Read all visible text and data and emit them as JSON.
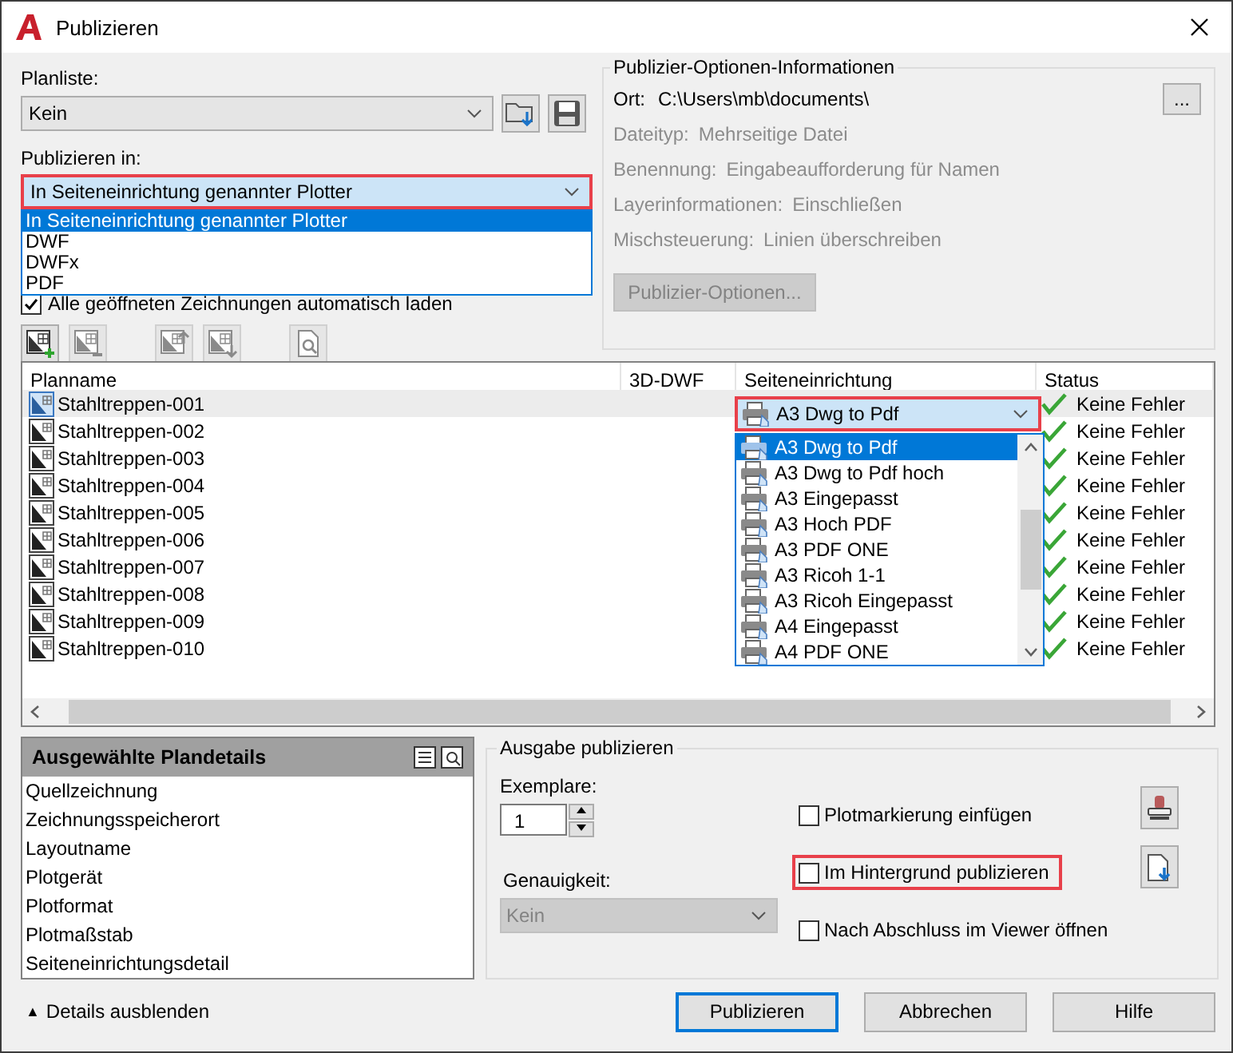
{
  "window": {
    "title": "Publizieren"
  },
  "sheet_list": {
    "label": "Planliste:",
    "value": "Kein"
  },
  "publish_to": {
    "label": "Publizieren in:",
    "value": "In Seiteneinrichtung genannter Plotter",
    "highlighted": true,
    "expanded": true,
    "options": [
      {
        "label": "In Seiteneinrichtung genannter Plotter",
        "selected": true
      },
      {
        "label": "DWF",
        "selected": false
      },
      {
        "label": "DWFx",
        "selected": false
      },
      {
        "label": "PDF",
        "selected": false
      }
    ]
  },
  "auto_load": {
    "label": "Alle geöffneten Zeichnungen automatisch laden",
    "checked": true
  },
  "toolbar": [
    {
      "kind": "add",
      "disabled": false
    },
    {
      "kind": "remove",
      "disabled": true
    },
    {
      "kind": "up",
      "disabled": true
    },
    {
      "kind": "down",
      "disabled": true
    },
    {
      "kind": "preview",
      "disabled": true
    }
  ],
  "publish_info": {
    "title": "Publizier-Optionen-Informationen",
    "location_label": "Ort:",
    "location_value": "C:\\Users\\mb\\documents\\",
    "browse": "...",
    "rows": [
      {
        "label": "Dateityp:",
        "value": "Mehrseitige Datei"
      },
      {
        "label": "Benennung:",
        "value": "Eingabeaufforderung für Namen"
      },
      {
        "label": "Layerinformationen:",
        "value": "Einschließen"
      },
      {
        "label": "Mischsteuerung:",
        "value": "Linien überschreiben"
      }
    ],
    "button": "Publizier-Optionen..."
  },
  "sheets": {
    "columns": [
      "Planname",
      "3D-DWF",
      "Seiteneinrichtung",
      "Status"
    ],
    "rows": [
      {
        "name": "Stahltreppen-001",
        "status": "Keine Fehler",
        "selected": true
      },
      {
        "name": "Stahltreppen-002",
        "status": "Keine Fehler",
        "selected": false
      },
      {
        "name": "Stahltreppen-003",
        "status": "Keine Fehler",
        "selected": false
      },
      {
        "name": "Stahltreppen-004",
        "status": "Keine Fehler",
        "selected": false
      },
      {
        "name": "Stahltreppen-005",
        "status": "Keine Fehler",
        "selected": false
      },
      {
        "name": "Stahltreppen-006",
        "status": "Keine Fehler",
        "selected": false
      },
      {
        "name": "Stahltreppen-007",
        "status": "Keine Fehler",
        "selected": false
      },
      {
        "name": "Stahltreppen-008",
        "status": "Keine Fehler",
        "selected": false
      },
      {
        "name": "Stahltreppen-009",
        "status": "Keine Fehler",
        "selected": false
      },
      {
        "name": "Stahltreppen-010",
        "status": "Keine Fehler",
        "selected": false
      }
    ]
  },
  "page_setup": {
    "value": "A3 Dwg to Pdf",
    "highlighted": true,
    "expanded": true,
    "options": [
      {
        "label": "A3 Dwg to Pdf",
        "selected": true
      },
      {
        "label": "A3 Dwg to Pdf hoch",
        "selected": false
      },
      {
        "label": "A3 Eingepasst",
        "selected": false
      },
      {
        "label": "A3 Hoch PDF",
        "selected": false
      },
      {
        "label": "A3 PDF ONE",
        "selected": false
      },
      {
        "label": "A3 Ricoh 1-1",
        "selected": false
      },
      {
        "label": "A3 Ricoh Eingepasst",
        "selected": false
      },
      {
        "label": "A4 Eingepasst",
        "selected": false
      },
      {
        "label": "A4 PDF ONE",
        "selected": false
      }
    ]
  },
  "details": {
    "title": "Ausgewählte Plandetails",
    "items": [
      "Quellzeichnung",
      "Zeichnungsspeicherort",
      "Layoutname",
      "Plotgerät",
      "Plotformat",
      "Plotmaßstab",
      "Seiteneinrichtungsdetail"
    ]
  },
  "output": {
    "title": "Ausgabe publizieren",
    "copies_label": "Exemplare:",
    "copies_value": "1",
    "precision_label": "Genauigkeit:",
    "precision_value": "Kein",
    "options": [
      {
        "label": "Plotmarkierung einfügen",
        "checked": false,
        "highlighted": false,
        "kind": "stamp"
      },
      {
        "label": "Im Hintergrund publizieren",
        "checked": false,
        "highlighted": true,
        "kind": "background"
      },
      {
        "label": "Nach Abschluss im Viewer öffnen",
        "checked": false,
        "highlighted": false,
        "kind": "none"
      }
    ]
  },
  "details_toggle": {
    "symbol": "▲",
    "label": "Details ausblenden"
  },
  "buttons": [
    {
      "label": "Publizieren",
      "default": true
    },
    {
      "label": "Abbrechen",
      "default": false
    },
    {
      "label": "Hilfe",
      "default": false
    }
  ]
}
